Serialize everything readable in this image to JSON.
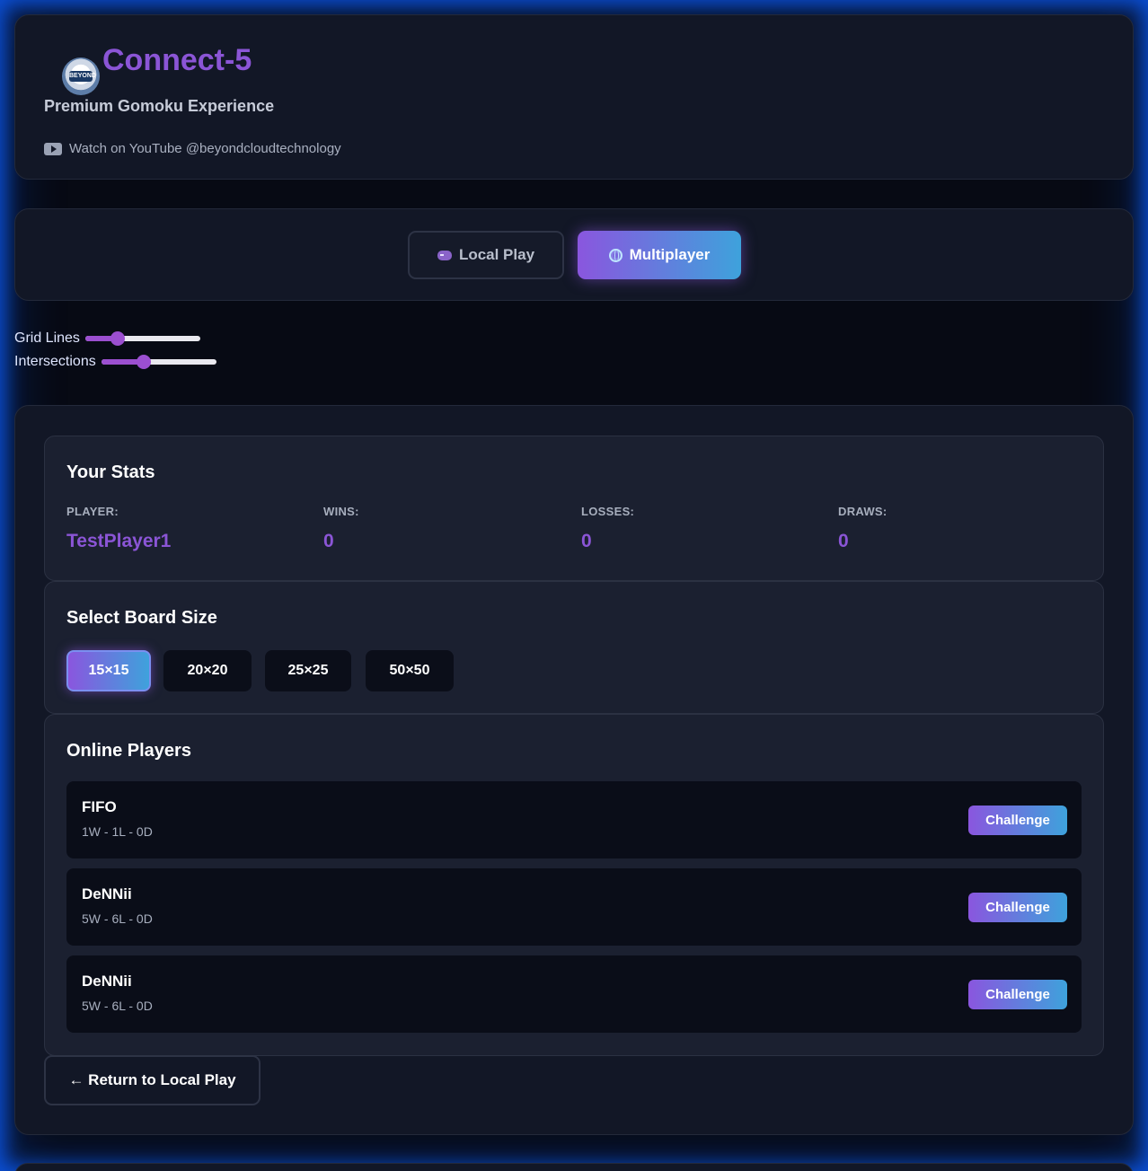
{
  "header": {
    "logo_text": "BEYOND",
    "title": "Connect-5",
    "subtitle": "Premium Gomoku Experience",
    "youtube_text": "Watch on YouTube @beyondcloudtechnology"
  },
  "mode": {
    "local_label": "Local Play",
    "multiplayer_label": "Multiplayer",
    "active": "Multiplayer"
  },
  "controls": {
    "grid_lines_label": "Grid Lines",
    "grid_lines_level": 0.25,
    "intersections_label": "Intersections",
    "intersections_level": 0.35
  },
  "stats": {
    "title": "Your Stats",
    "player_label": "PLAYER:",
    "player_value": "TestPlayer1",
    "wins_label": "WINS:",
    "wins_value": "0",
    "losses_label": "LOSSES:",
    "losses_value": "0",
    "draws_label": "DRAWS:",
    "draws_value": "0"
  },
  "board_size": {
    "title": "Select Board Size",
    "options": [
      "15×15",
      "20×20",
      "25×25",
      "50×50"
    ],
    "selected": "15×15"
  },
  "online_players": {
    "title": "Online Players",
    "challenge_label": "Challenge",
    "players": [
      {
        "name": "FIFO",
        "record": "1W - 1L - 0D"
      },
      {
        "name": "DeNNii",
        "record": "5W - 6L - 0D"
      },
      {
        "name": "DeNNii",
        "record": "5W - 6L - 0D"
      }
    ]
  },
  "return_label": "← Return to Local Play",
  "colors": {
    "accent_purple": "#8b55d6",
    "accent_blue": "#3ea2dc",
    "background": "#070a14",
    "glow": "#0b4fd6"
  }
}
